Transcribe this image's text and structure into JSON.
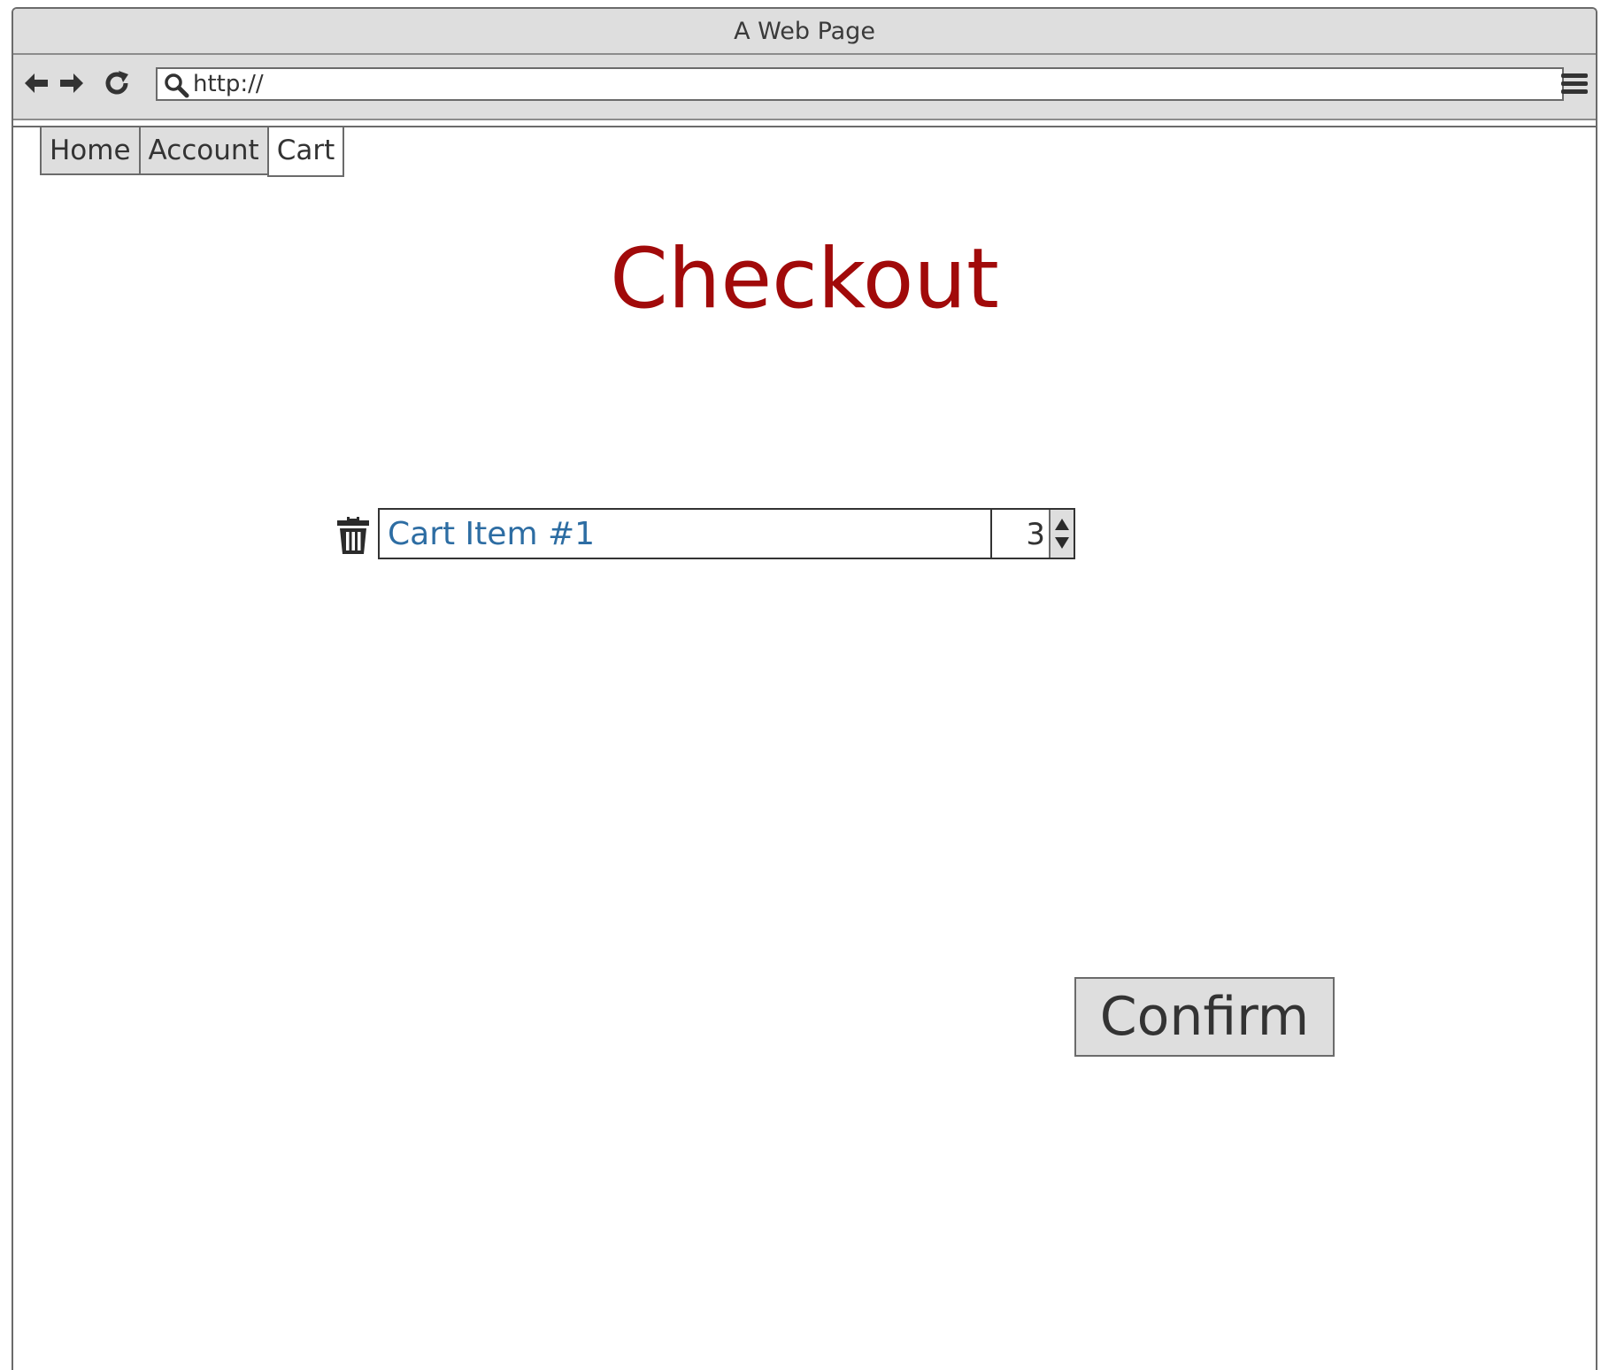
{
  "window": {
    "title": "A Web Page"
  },
  "toolbar": {
    "back_icon": "arrow-left-icon",
    "forward_icon": "arrow-right-icon",
    "reload_icon": "reload-icon",
    "url_value": "http://",
    "search_icon": "search-icon",
    "menu_icon": "hamburger-menu-icon"
  },
  "tabs": [
    {
      "label": "Home",
      "active": false
    },
    {
      "label": "Account",
      "active": false
    },
    {
      "label": "Cart",
      "active": true
    }
  ],
  "page": {
    "title": "Checkout",
    "title_color": "#a10a0a"
  },
  "cart": {
    "items": [
      {
        "name": "Cart Item #1",
        "quantity": "3",
        "delete_icon": "trash-icon"
      }
    ],
    "item_link_color": "#2d6da3"
  },
  "actions": {
    "confirm_label": "Confirm"
  }
}
